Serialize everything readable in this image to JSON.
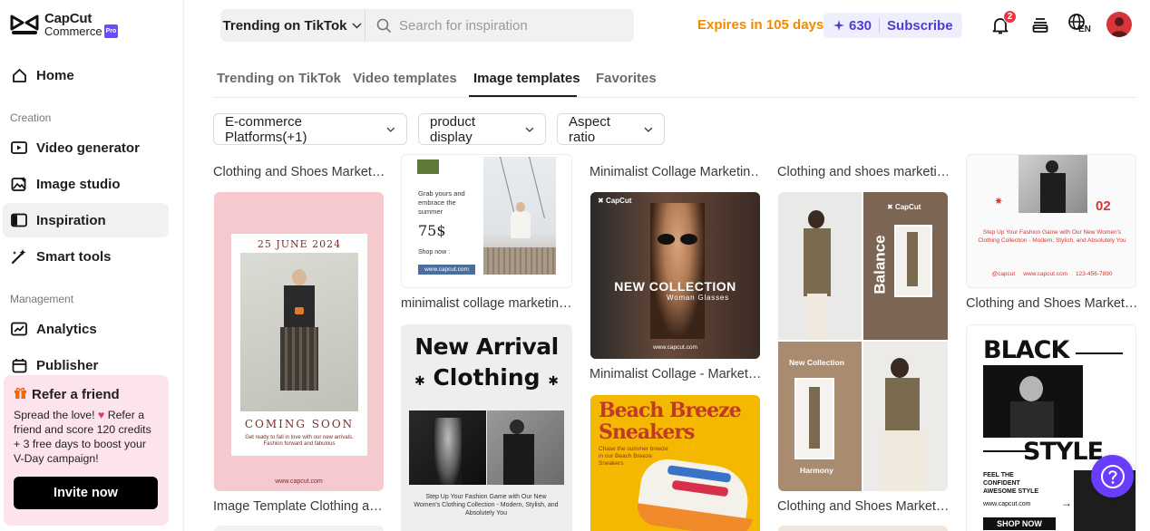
{
  "brand": {
    "line1": "CapCut",
    "line2": "Commerce",
    "badge": "Pro"
  },
  "sidebar": {
    "home": "Home",
    "section_creation": "Creation",
    "video_generator": "Video generator",
    "image_studio": "Image studio",
    "inspiration": "Inspiration",
    "smart_tools": "Smart tools",
    "section_management": "Management",
    "analytics": "Analytics",
    "publisher": "Publisher"
  },
  "refer": {
    "title": "Refer a friend",
    "body_1": "Spread the love! ",
    "body_2": " Refer a friend and score 120 credits + 3 free days to boost your V-Day campaign!",
    "button": "Invite now"
  },
  "search": {
    "category": "Trending on TikTok",
    "placeholder": "Search for inspiration"
  },
  "header": {
    "expires": "Expires in 105 days",
    "credits": "630",
    "subscribe": "Subscribe",
    "notification_count": "2",
    "language": "EN"
  },
  "tabs": [
    "Trending on TikTok",
    "Video templates",
    "Image templates",
    "Favorites"
  ],
  "filters": [
    "E-commerce Platforms(+1)",
    "product display",
    "Aspect ratio"
  ],
  "cards": {
    "c1_top_title": "Clothing and Shoes Market…",
    "c1_date": "25 JUNE 2024",
    "c1_coming": "COMING SOON",
    "c1_caption": "Get ready to fall in love with our new arrivals. Fashion forward and fabulous",
    "c1_url": "www.capcut.com",
    "c1_title": "Image Template Clothing a…",
    "c2_text": "Grab yours and embrace the summer",
    "c2_price": "75$",
    "c2_shop": "Shop now :",
    "c2_url": "www.capcut.com",
    "c2_title": "minimalist collage marketin…",
    "c3_line1": "New Arrival",
    "c3_line2": "Clothing",
    "c3_caption": "Step Up Your Fashion Game with Our New Women's Clothing Collection - Modern, Stylish, and Absolutely You",
    "c4_top_title": "Minimalist Collage Marketin…",
    "c4_logo": "CapCut",
    "c4_headline": "NEW COLLECTION",
    "c4_sub": "Woman Glasses",
    "c4_url": "www.capcut.com",
    "c4_title": "Minimalist Collage - Market…",
    "c5_line1": "Beach Breeze",
    "c5_line2": "Sneakers",
    "c5_caption": "Chase the summer breeze in our Beach Breeze Sneakers",
    "c6_top_title": "Clothing and shoes marketi…",
    "c6_logo": "CapCut",
    "c6_balance": "Balance",
    "c6_newcol": "New Collection",
    "c6_harmony": "Harmony",
    "c6_title": "Clothing and Shoes Market…",
    "c7_num": "02",
    "c7_caption": "Step Up Your Fashion Game with Our New Women's Clothing Collection - Modern, Stylish, and Absolutely You",
    "c7_contact": "@capcut     www.capcut.com     123-456-7890",
    "c7_title": "Clothing and Shoes Market…",
    "c8_black": "BLACK",
    "c8_style": "STYLE",
    "c8_feel": "FEEL THE CONFIDENT AWESOME STYLE",
    "c8_url": "www.capcut.com",
    "c8_shop": "SHOP NOW"
  },
  "colors": {
    "accent": "#6a3cff",
    "expires": "#f08a00",
    "credits_text": "#4c3fcf",
    "refer_bg": "#fde3ee"
  }
}
